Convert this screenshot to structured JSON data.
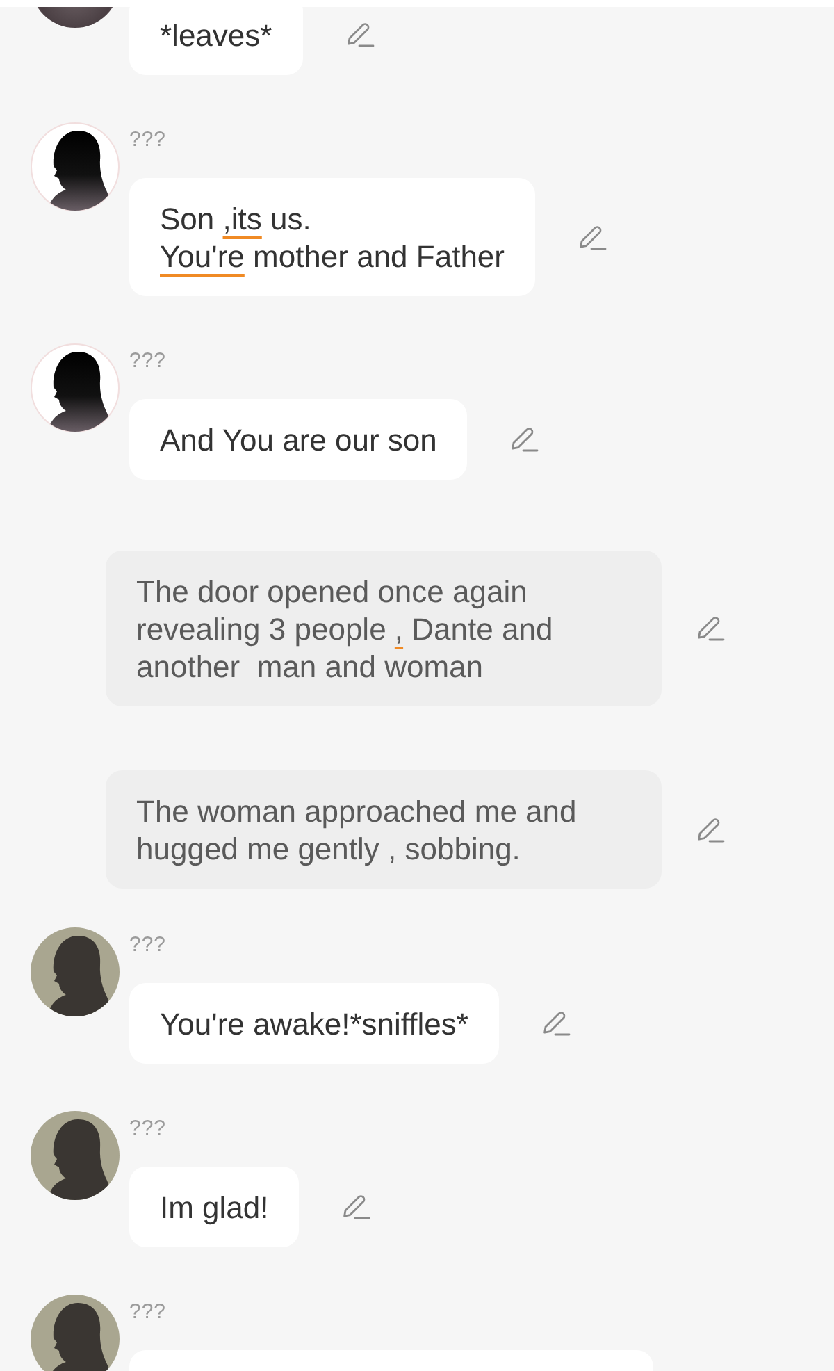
{
  "messages": [
    {
      "kind": "character",
      "avatar": {
        "kind": "photo"
      },
      "text": [
        {
          "text": "*leaves*",
          "flagged": false
        }
      ]
    },
    {
      "kind": "character",
      "avatar": {
        "kind": "dark"
      },
      "name": "???",
      "text": [
        {
          "text": "Son ",
          "flagged": false
        },
        {
          "text": ",its",
          "flagged": true
        },
        {
          "text": " us.\n",
          "flagged": false
        },
        {
          "text": "You're",
          "flagged": true
        },
        {
          "text": " mother and Father",
          "flagged": false
        }
      ]
    },
    {
      "kind": "character",
      "avatar": {
        "kind": "dark"
      },
      "name": "???",
      "text": [
        {
          "text": "And You are our son",
          "flagged": false
        }
      ]
    },
    {
      "kind": "narration",
      "text": [
        {
          "text": "The door opened once again revealing 3 people ",
          "flagged": false
        },
        {
          "text": ",",
          "flagged": true
        },
        {
          "text": " Dante and another  man and woman",
          "flagged": false
        }
      ]
    },
    {
      "kind": "narration",
      "text": [
        {
          "text": "The woman approached me and hugged me gently , sobbing.",
          "flagged": false
        }
      ]
    },
    {
      "kind": "character",
      "avatar": {
        "kind": "olive"
      },
      "name": "???",
      "text": [
        {
          "text": "You're awake!*sniffles*",
          "flagged": false
        }
      ]
    },
    {
      "kind": "character",
      "avatar": {
        "kind": "olive"
      },
      "name": "???",
      "text": [
        {
          "text": "Im glad!",
          "flagged": false
        }
      ]
    },
    {
      "kind": "character",
      "avatar": {
        "kind": "olive"
      },
      "name": "???"
    }
  ]
}
